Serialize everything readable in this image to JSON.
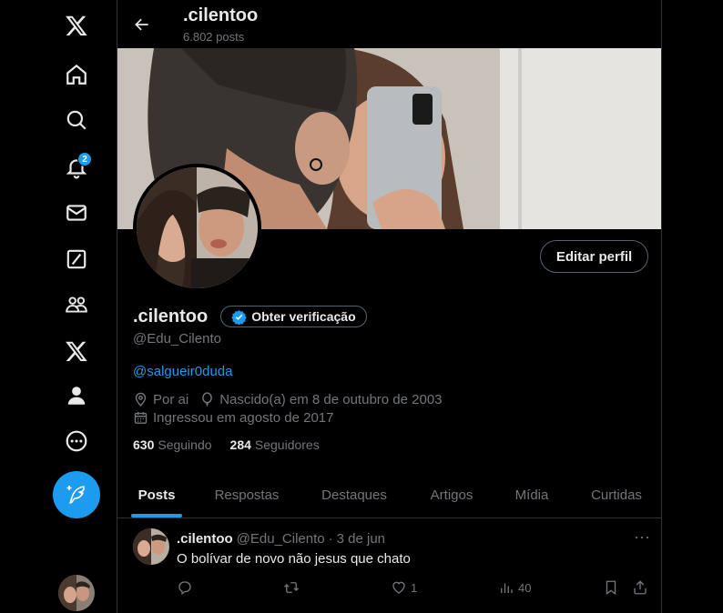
{
  "sidebar": {
    "items": [
      {
        "icon": "x-logo-icon"
      },
      {
        "icon": "home-icon"
      },
      {
        "icon": "search-icon"
      },
      {
        "icon": "bell-icon",
        "badge": "2"
      },
      {
        "icon": "mail-icon"
      },
      {
        "icon": "grok-icon"
      },
      {
        "icon": "communities-icon"
      },
      {
        "icon": "premium-x-icon"
      },
      {
        "icon": "profile-icon"
      },
      {
        "icon": "more-circle-icon"
      }
    ],
    "post_button_icon": "feather-plus-icon"
  },
  "header": {
    "title": ".cilentoo",
    "posts_count": "6.802 posts"
  },
  "profile": {
    "edit_button": "Editar perfil",
    "display_name": ".cilentoo",
    "verify_button": "Obter verificação",
    "handle": "@Edu_Cilento",
    "bio_link": "@salgueir0duda",
    "location": "Por ai",
    "birthday": "Nascido(a) em 8 de outubro de 2003",
    "joined": "Ingressou em agosto de 2017",
    "following_count": "630",
    "following_label": "Seguindo",
    "followers_count": "284",
    "followers_label": "Seguidores"
  },
  "tabs": [
    {
      "label": "Posts",
      "active": true
    },
    {
      "label": "Respostas"
    },
    {
      "label": "Destaques"
    },
    {
      "label": "Artigos"
    },
    {
      "label": "Mídia"
    },
    {
      "label": "Curtidas"
    }
  ],
  "tweet": {
    "name": ".cilentoo",
    "handle": "@Edu_Cilento",
    "separator": "·",
    "date": "3 de jun",
    "text": "O bolívar de novo não jesus que chato",
    "replies": "",
    "reposts": "",
    "likes": "1",
    "views": "40"
  },
  "colors": {
    "accent": "#1d9bf0",
    "background": "#000000",
    "text": "#e7e9ea",
    "muted": "#71767b"
  }
}
